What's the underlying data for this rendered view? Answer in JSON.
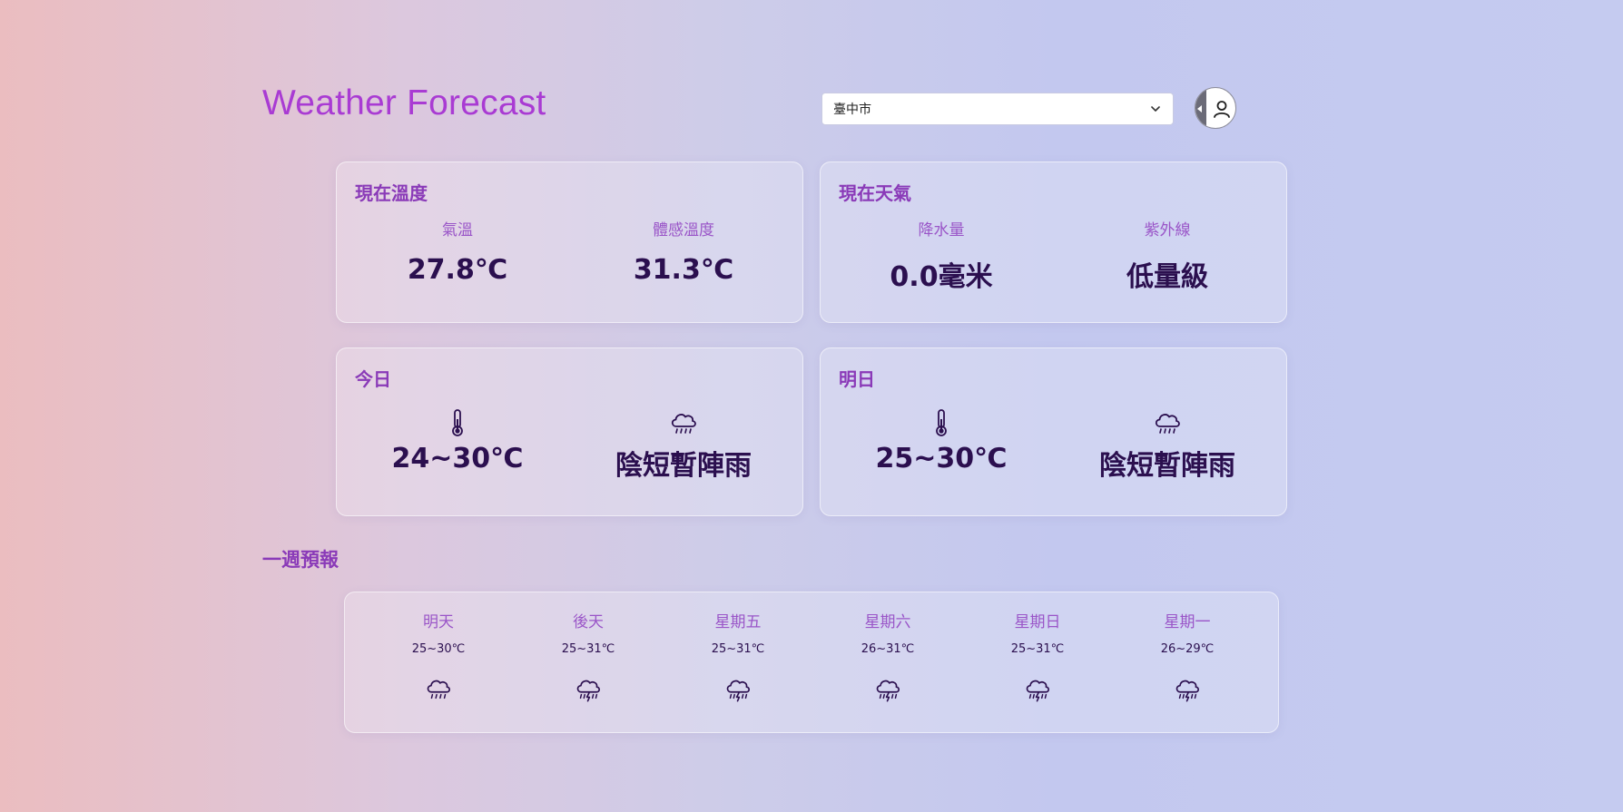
{
  "header": {
    "title": "Weather Forecast",
    "city_select": {
      "value": "臺中市",
      "icon": "chevron-down-icon"
    },
    "avatar": {
      "icon": "user-icon"
    }
  },
  "current_temp": {
    "title": "現在溫度",
    "items": [
      {
        "label": "氣溫",
        "value": "27.8℃"
      },
      {
        "label": "體感溫度",
        "value": "31.3℃"
      }
    ]
  },
  "current_weather": {
    "title": "現在天氣",
    "items": [
      {
        "label": "降水量",
        "value": "0.0毫米"
      },
      {
        "label": "紫外線",
        "value": "低量級"
      }
    ]
  },
  "today": {
    "title": "今日",
    "temp": "24~30℃",
    "temp_icon": "thermometer-icon",
    "weather": "陰短暫陣雨",
    "weather_icon": "rain-cloud-icon"
  },
  "tomorrow": {
    "title": "明日",
    "temp": "25~30℃",
    "temp_icon": "thermometer-icon",
    "weather": "陰短暫陣雨",
    "weather_icon": "rain-cloud-icon"
  },
  "week": {
    "title": "一週預報",
    "days": [
      {
        "day": "明天",
        "temp": "25~30℃",
        "icon": "rain-cloud-icon"
      },
      {
        "day": "後天",
        "temp": "25~31℃",
        "icon": "thunderstorm-icon"
      },
      {
        "day": "星期五",
        "temp": "25~31℃",
        "icon": "thunderstorm-icon"
      },
      {
        "day": "星期六",
        "temp": "26~31℃",
        "icon": "thunderstorm-icon"
      },
      {
        "day": "星期日",
        "temp": "25~31℃",
        "icon": "thunderstorm-icon"
      },
      {
        "day": "星期一",
        "temp": "26~29℃",
        "icon": "thunderstorm-icon"
      }
    ]
  },
  "colors": {
    "accent": "#a93bd3",
    "label": "#9a55c8",
    "value": "#2b0f4f"
  }
}
